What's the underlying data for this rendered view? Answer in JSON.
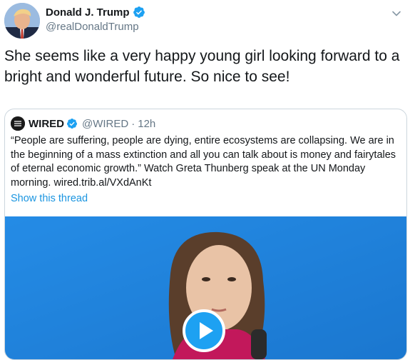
{
  "tweet": {
    "display_name": "Donald J. Trump",
    "handle": "@realDonaldTrump",
    "text": "She seems like a very happy young girl looking forward to a bright and wonderful future. So nice to see!",
    "icons": {
      "verified": "verified-badge-icon",
      "more": "chevron-down-icon"
    }
  },
  "quoted": {
    "name": "WIRED",
    "handle": "@WIRED",
    "separator": "·",
    "time": "12h",
    "text": "“People are suffering, people are dying, entire ecosystems are collapsing. We are in the beginning of a mass extinction and all you can talk about is money and fairytales of eternal economic growth.” Watch Greta Thunberg speak at the UN Monday morning. wired.trib.al/VXdAnKt",
    "show_thread": "Show this thread",
    "media": {
      "type": "video",
      "play_icon": "play-icon"
    }
  },
  "colors": {
    "verified": "#1da1f2",
    "link": "#1b95e0",
    "secondary_text": "#657786",
    "border": "#ccd6dd",
    "media_background": "#1e88e5"
  }
}
